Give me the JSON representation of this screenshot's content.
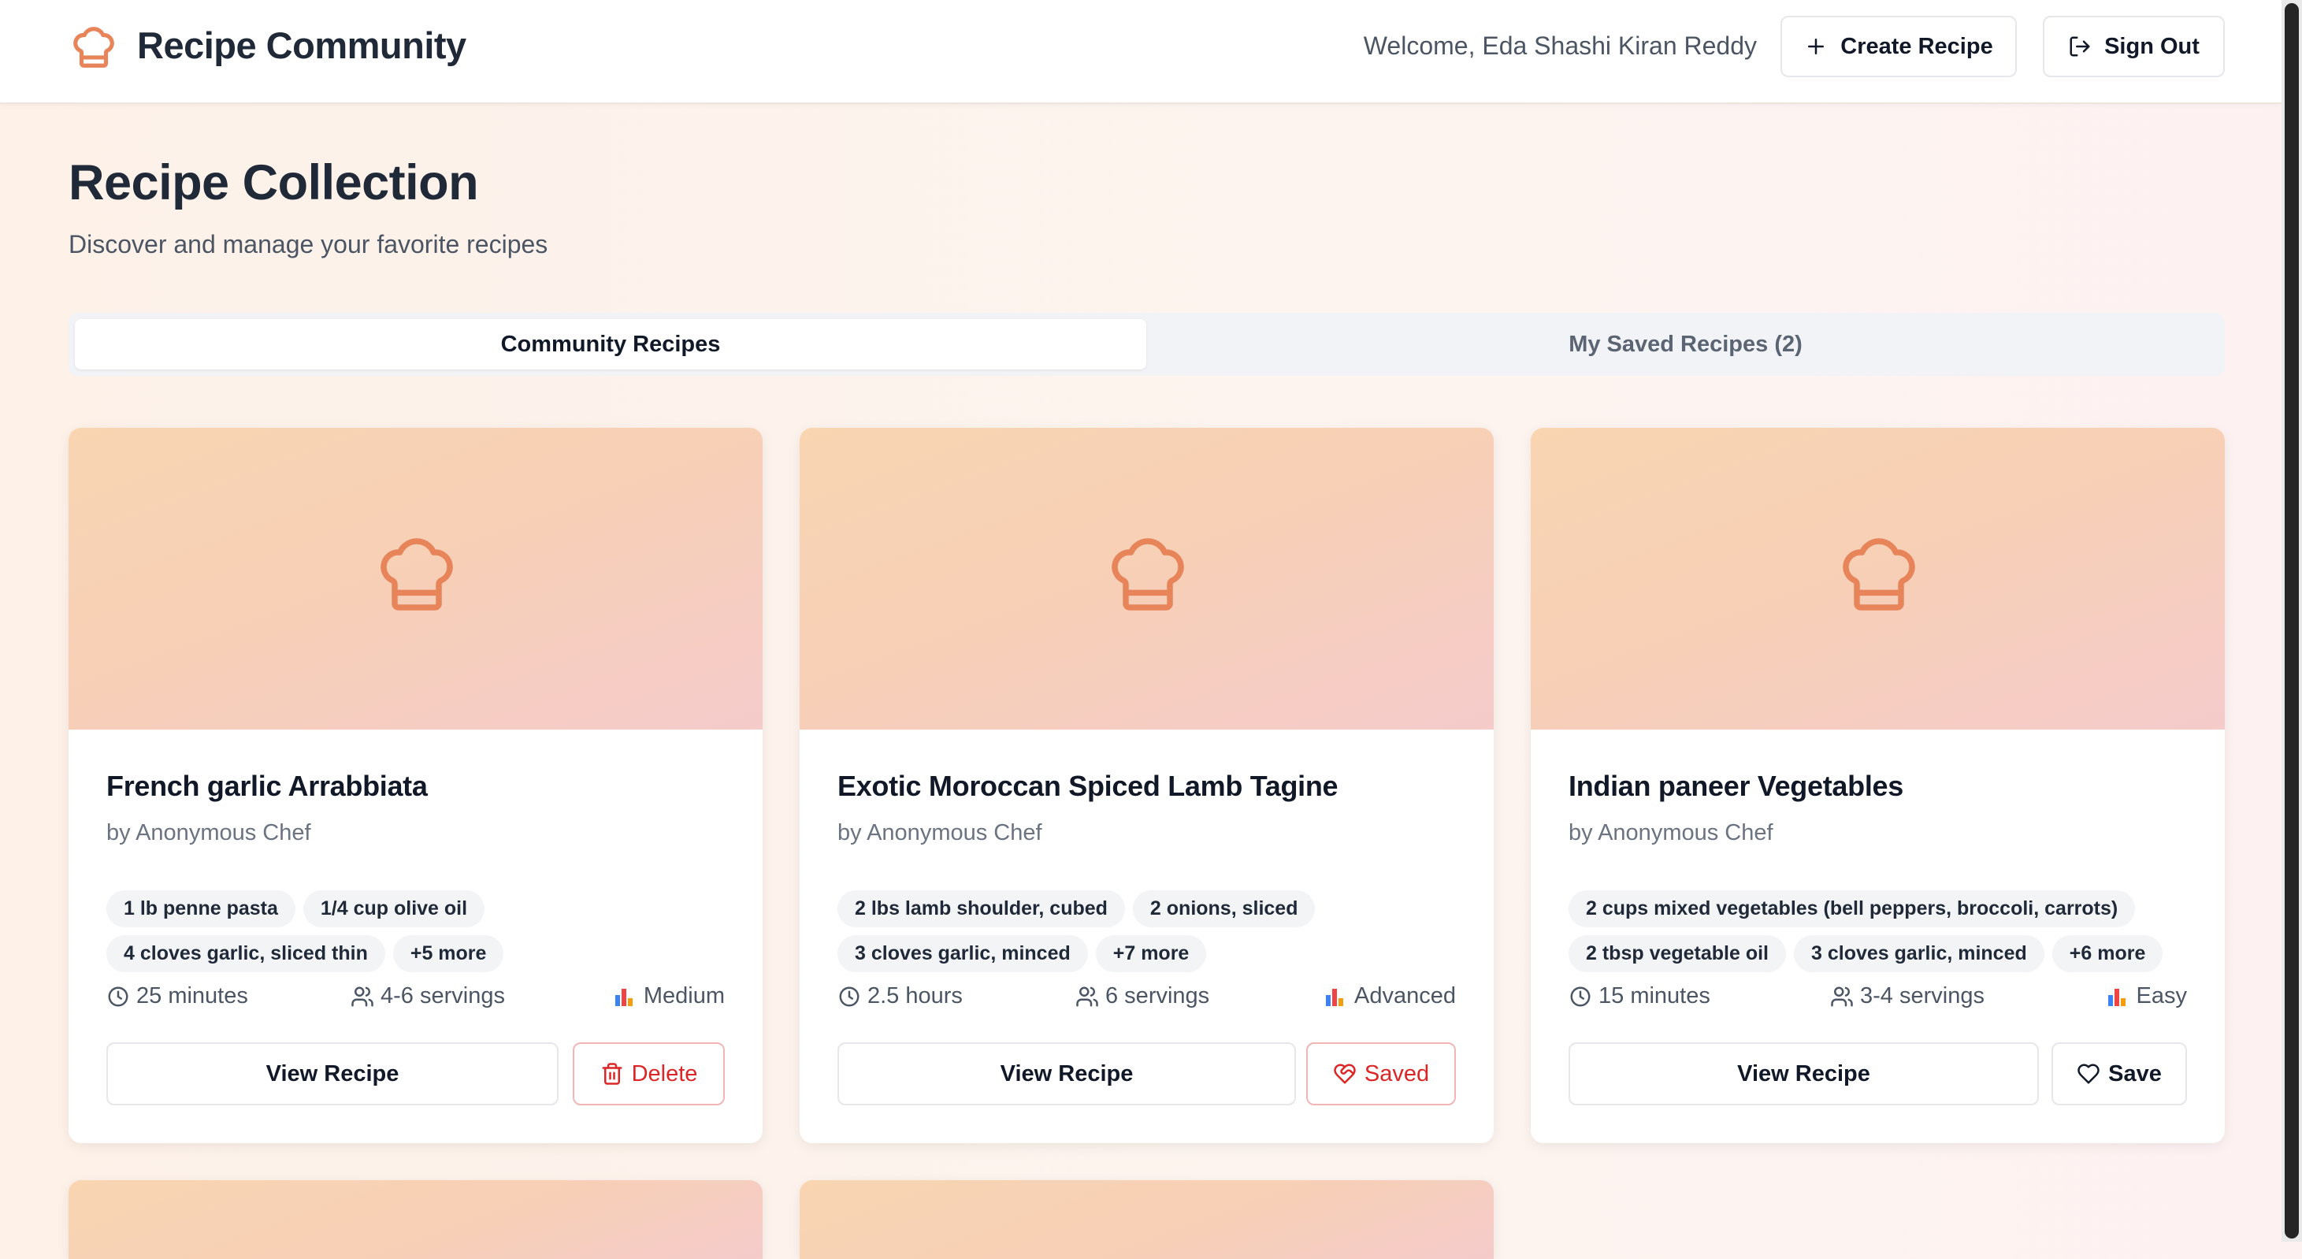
{
  "header": {
    "brand": "Recipe Community",
    "welcome": "Welcome, Eda Shashi Kiran Reddy",
    "create_label": "Create Recipe",
    "signout_label": "Sign Out"
  },
  "page": {
    "title": "Recipe Collection",
    "subtitle": "Discover and manage your favorite recipes"
  },
  "tabs": [
    {
      "label": "Community Recipes",
      "active": true
    },
    {
      "label": "My Saved Recipes (2)",
      "active": false
    }
  ],
  "colors": {
    "accent": "#e8845a",
    "danger": "#dc2626"
  },
  "recipes": [
    {
      "title": "French garlic Arrabbiata",
      "author": "by Anonymous Chef",
      "tags": [
        "1 lb penne pasta",
        "1/4 cup olive oil",
        "4 cloves garlic, sliced thin",
        "+5 more"
      ],
      "time": "25 minutes",
      "servings": "4-6 servings",
      "difficulty": "Medium",
      "view_label": "View Recipe",
      "action_label": "Delete",
      "action_icon": "trash-icon"
    },
    {
      "title": "Exotic Moroccan Spiced Lamb Tagine",
      "author": "by Anonymous Chef",
      "tags": [
        "2 lbs lamb shoulder, cubed",
        "2 onions, sliced",
        "3 cloves garlic, minced",
        "+7 more"
      ],
      "time": "2.5 hours",
      "servings": "6 servings",
      "difficulty": "Advanced",
      "view_label": "View Recipe",
      "action_label": "Saved",
      "action_icon": "heart-filled-icon"
    },
    {
      "title": "Indian paneer Vegetables",
      "author": "by Anonymous Chef",
      "tags": [
        "2 cups mixed vegetables (bell peppers, broccoli, carrots)",
        "2 tbsp vegetable oil",
        "3 cloves garlic, minced",
        "+6 more"
      ],
      "time": "15 minutes",
      "servings": "3-4 servings",
      "difficulty": "Easy",
      "view_label": "View Recipe",
      "action_label": "Save",
      "action_icon": "heart-icon"
    }
  ]
}
